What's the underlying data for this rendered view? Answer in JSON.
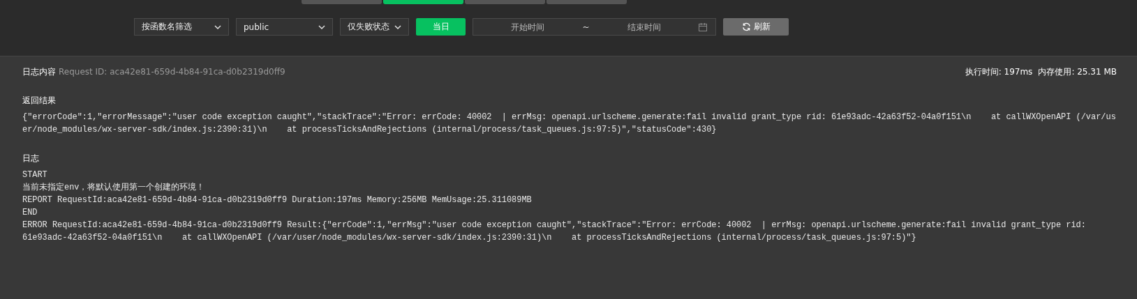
{
  "tabs": [
    {
      "selected": false
    },
    {
      "selected": true
    },
    {
      "selected": false
    },
    {
      "selected": false
    }
  ],
  "filters": {
    "function_select": "按函数名筛选",
    "namespace_select": "public",
    "status_select": "仅失败状态",
    "today_button": "当日",
    "start_placeholder": "开始时间",
    "range_separator": "~",
    "end_placeholder": "结束时间",
    "refresh_button": "刷新"
  },
  "log_header": {
    "title": "日志内容",
    "request_id": "Request ID: aca42e81-659d-4b84-91ca-d0b2319d0ff9",
    "exec_time": "执行时间: 197ms",
    "memory": "内存使用: 25.31 MB"
  },
  "result": {
    "title": "返回结果",
    "text": "{\"errorCode\":1,\"errorMessage\":\"user code exception caught\",\"stackTrace\":\"Error: errCode: 40002  | errMsg: openapi.urlscheme.generate:fail invalid grant_type rid: 61e93adc-42a63f52-04a0f151\\n    at callWXOpenAPI (/var/user/node_modules/wx-server-sdk/index.js:2390:31)\\n    at processTicksAndRejections (internal/process/task_queues.js:97:5)\",\"statusCode\":430}"
  },
  "log": {
    "title": "日志",
    "lines": [
      "START",
      "当前未指定env，将默认使用第一个创建的环境！",
      "REPORT RequestId:aca42e81-659d-4b84-91ca-d0b2319d0ff9 Duration:197ms Memory:256MB MemUsage:25.311089MB",
      "END",
      "ERROR RequestId:aca42e81-659d-4b84-91ca-d0b2319d0ff9 Result:{\"errCode\":1,\"errMsg\":\"user code exception caught\",\"stackTrace\":\"Error: errCode: 40002  | errMsg: openapi.urlscheme.generate:fail invalid grant_type rid: 61e93adc-42a63f52-04a0f151\\n    at callWXOpenAPI (/var/user/node_modules/wx-server-sdk/index.js:2390:31)\\n    at processTicksAndRejections (internal/process/task_queues.js:97:5)\"}"
    ]
  }
}
